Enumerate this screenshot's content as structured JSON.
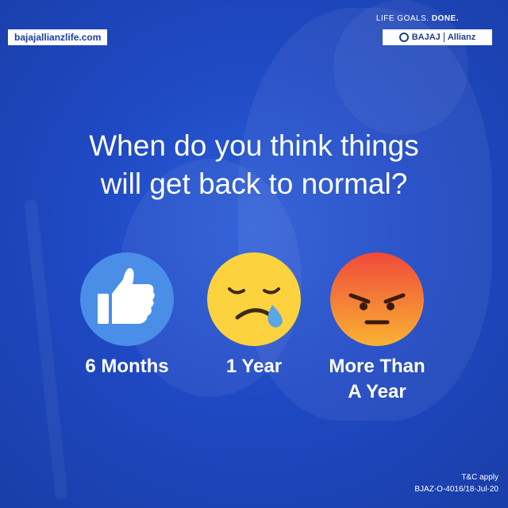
{
  "header": {
    "website": "bajajallianzlife.com",
    "tagline_regular": "LIFE GOALS.",
    "tagline_bold": "DONE.",
    "logo_brand": "BAJAJ",
    "logo_partner": "Allianz"
  },
  "question": {
    "line1": "When do you think things",
    "line2": "will get back to normal?"
  },
  "options": [
    {
      "icon": "thumbs-up-icon",
      "label": "6 Months",
      "color": "#4a8ee8"
    },
    {
      "icon": "sad-crying-face-icon",
      "label": "1 Year",
      "color": "#fdd23f"
    },
    {
      "icon": "angry-face-icon",
      "label_line1": "More Than",
      "label_line2": "A Year",
      "color": "#f25b2a"
    }
  ],
  "footer": {
    "tnc": "T&C apply",
    "code": "BJAZ-O-4016/18-Jul-20"
  },
  "colors": {
    "background": "#1f49c4",
    "text": "#ffffff",
    "brand_blue": "#1f3f8a"
  }
}
